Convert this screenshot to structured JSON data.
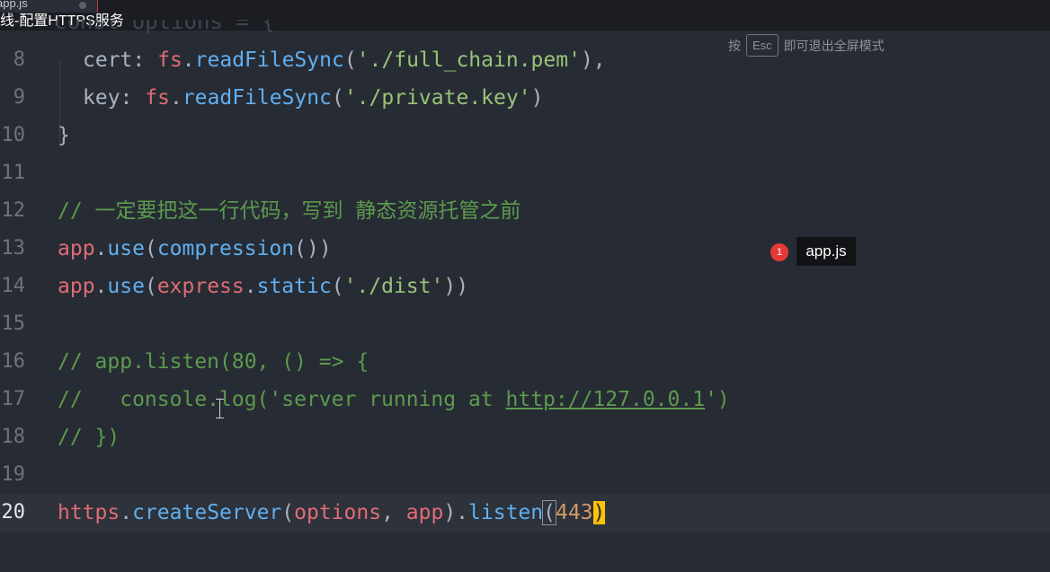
{
  "titlebar": {
    "tab_label": "app.js",
    "video_title": "线-配置HTTPS服务"
  },
  "esc_hint": {
    "prefix": "按",
    "key": "Esc",
    "suffix": "即可退出全屏模式"
  },
  "tooltip": {
    "badge": "1",
    "label": "app.js"
  },
  "editor": {
    "partial_top_line": "const options = {",
    "line_numbers": [
      "8",
      "9",
      "10",
      "11",
      "12",
      "13",
      "14",
      "15",
      "16",
      "17",
      "18",
      "19",
      "20"
    ],
    "current_line": "20",
    "lines": {
      "l8": {
        "key": "cert",
        "colon": ": ",
        "obj": "fs",
        "dot": ".",
        "fn": "readFileSync",
        "open": "(",
        "str": "'./full_chain.pem'",
        "close": "),"
      },
      "l9": {
        "key": "key",
        "colon": ": ",
        "obj": "fs",
        "dot": ".",
        "fn": "readFileSync",
        "open": "(",
        "str": "'./private.key'",
        "close": ")"
      },
      "l10": {
        "brace": "}"
      },
      "l12": {
        "comment": "// 一定要把这一行代码，写到 静态资源托管之前"
      },
      "l13": {
        "obj": "app",
        "dot": ".",
        "fn": "use",
        "open": "(",
        "fn2": "compression",
        "close": "())"
      },
      "l14": {
        "obj": "app",
        "dot": ".",
        "fn": "use",
        "open": "(",
        "obj2": "express",
        "dot2": ".",
        "fn2": "static",
        "open2": "(",
        "str": "'./dist'",
        "close": "))"
      },
      "l16": {
        "comment": "// app.listen(80, () => {"
      },
      "l17": {
        "comment_a": "//   console.log('server running at ",
        "link": "http://127.0.0.1",
        "comment_b": "')"
      },
      "l18": {
        "comment": "// })"
      },
      "l20": {
        "obj": "https",
        "dot": ".",
        "fn": "createServer",
        "open": "(",
        "arg1": "options",
        "sep": ", ",
        "arg2": "app",
        "close1": ").",
        "fn2": "listen",
        "open2": "(",
        "num": "443",
        "close2": ")"
      }
    }
  },
  "colors": {
    "background": "#272c34",
    "identifier_red": "#e06c75",
    "function_blue": "#61afef",
    "string_green": "#98c379",
    "number_orange": "#d19a66",
    "comment_green": "#5c9a4e",
    "cursor_yellow": "#ffc107",
    "badge_red": "#e53935"
  }
}
